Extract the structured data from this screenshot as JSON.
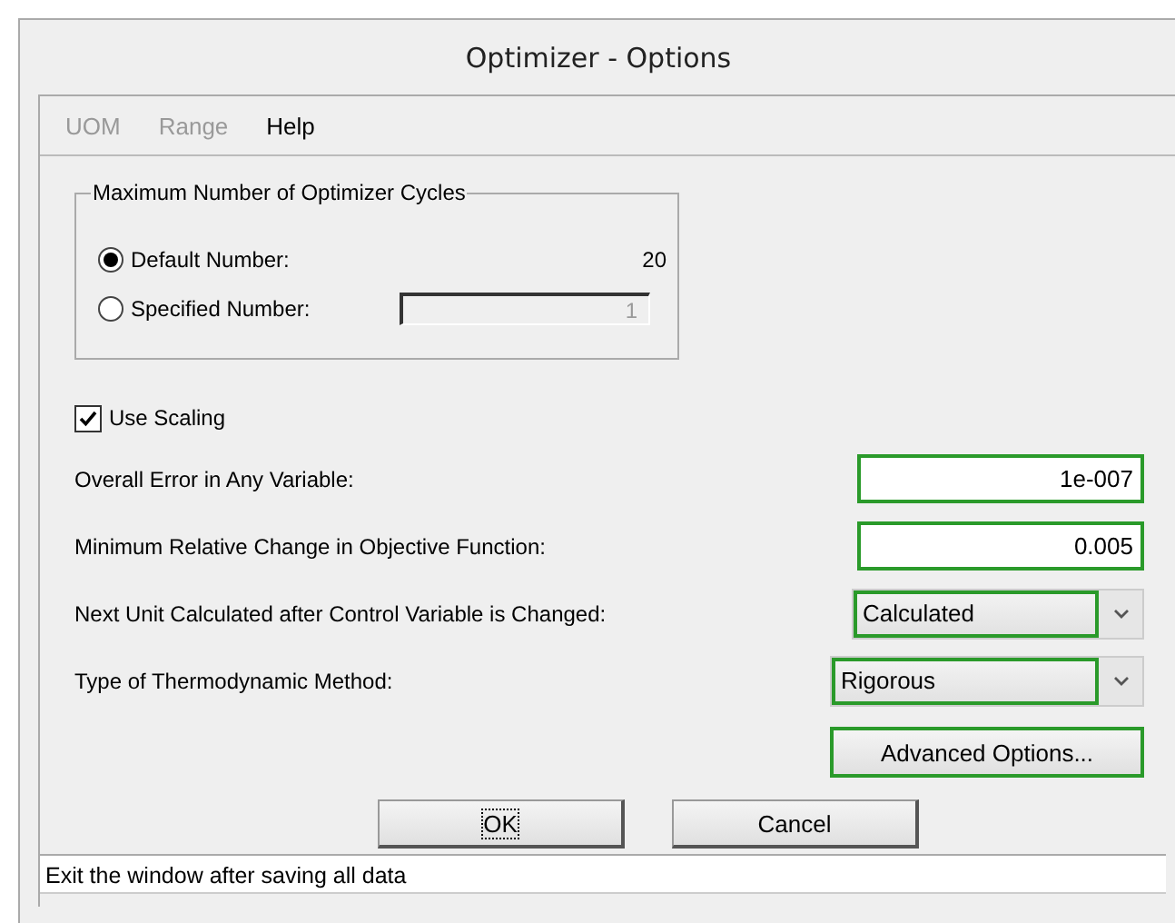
{
  "window": {
    "title": "Optimizer - Options"
  },
  "menu": [
    {
      "label": "UOM",
      "disabled": true
    },
    {
      "label": "Range",
      "disabled": true
    },
    {
      "label": "Help",
      "disabled": false
    }
  ],
  "cycles_group": {
    "title": "Maximum Number of Optimizer Cycles",
    "options": [
      {
        "label": "Default Number:",
        "selected": true,
        "kind": "value",
        "value": "20"
      },
      {
        "label": "Specified Number:",
        "selected": false,
        "kind": "field",
        "value": "1",
        "disabled": true
      }
    ]
  },
  "use_scaling": {
    "label": "Use Scaling",
    "checked": true
  },
  "settings": [
    {
      "kind": "field",
      "label": "Overall Error in Any Variable:",
      "value": "1e-007"
    },
    {
      "kind": "field",
      "label": "Minimum Relative Change in Objective Function:",
      "value": "0.005"
    },
    {
      "kind": "dropdown",
      "label": "Next Unit Calculated after Control Variable is Changed:",
      "value": "Calculated"
    },
    {
      "kind": "dropdown",
      "label": "Type of Thermodynamic Method:",
      "value": "Rigorous",
      "wide": true
    }
  ],
  "advanced_button": "Advanced Options...",
  "buttons": [
    {
      "label": "OK",
      "focused": true
    },
    {
      "label": "Cancel",
      "focused": false
    }
  ],
  "status_bar": "Exit the window after saving all data"
}
